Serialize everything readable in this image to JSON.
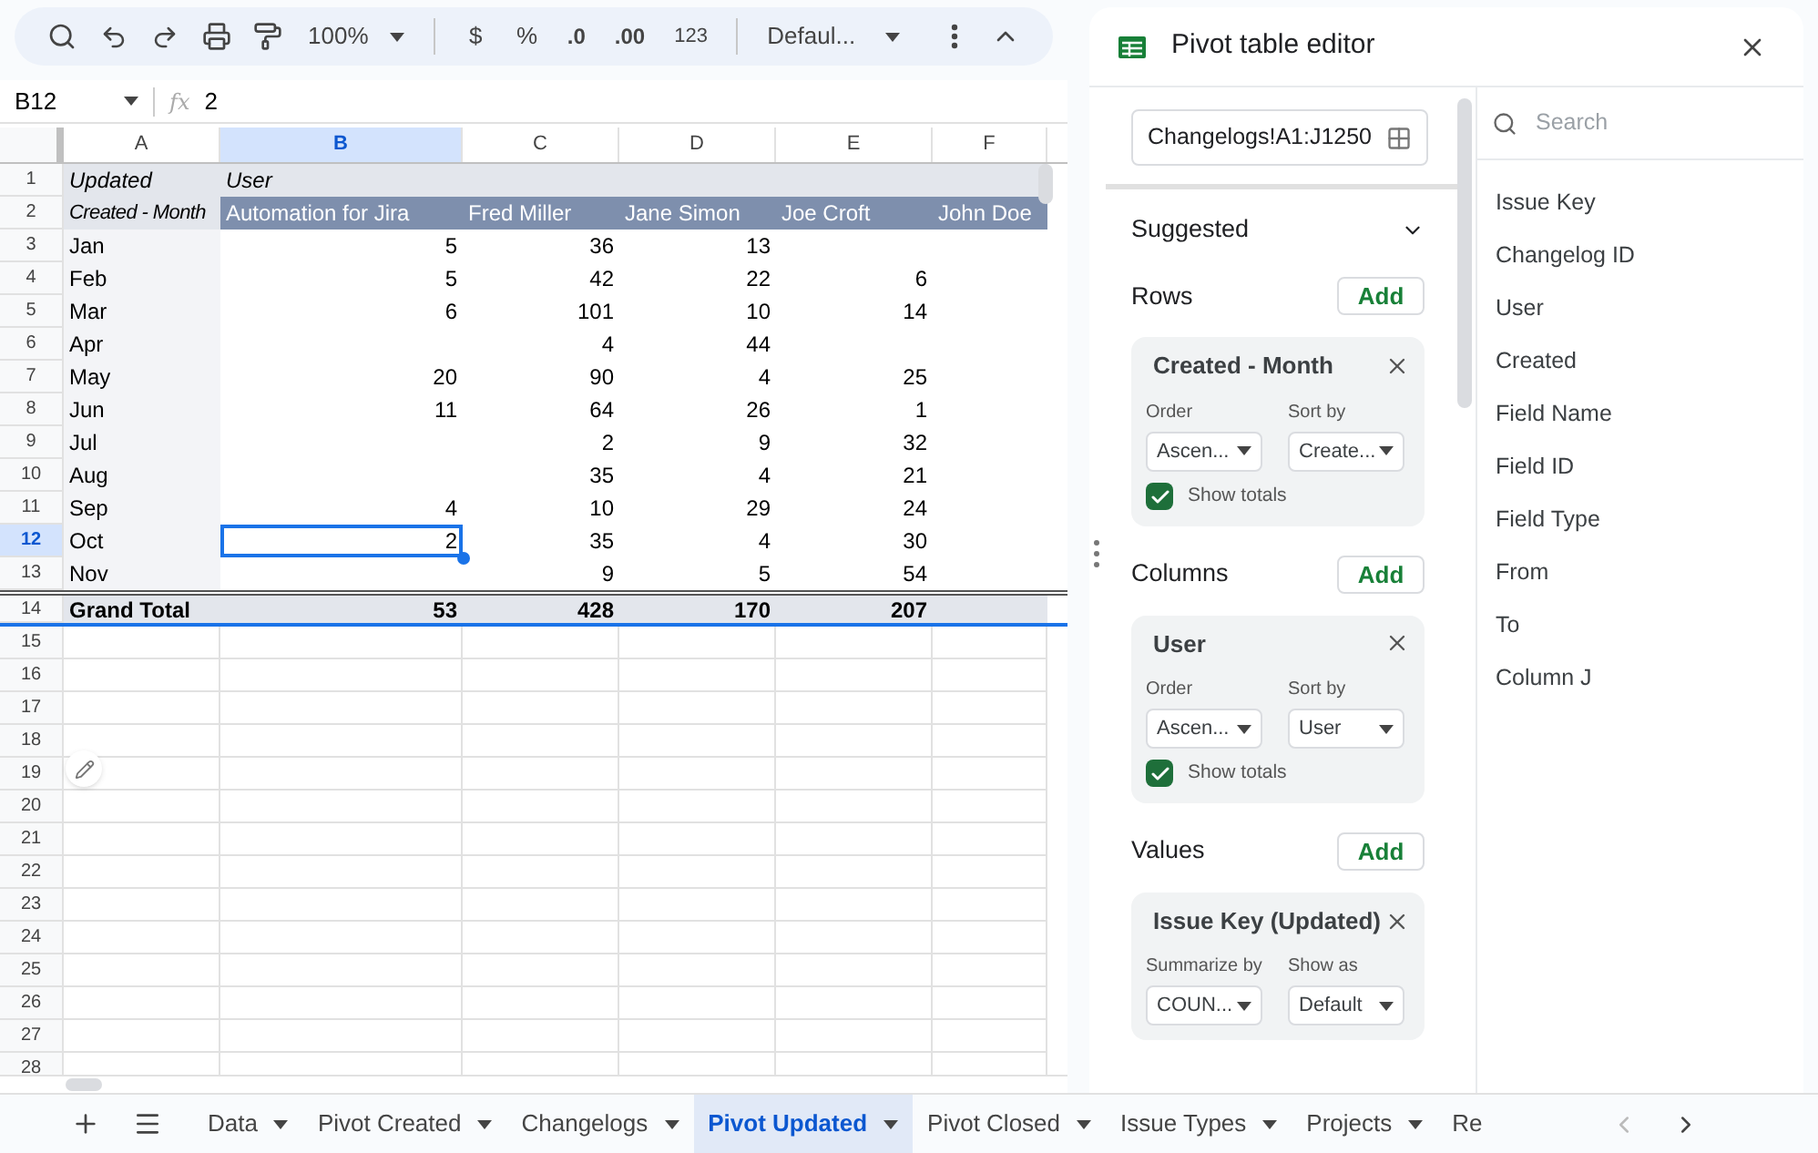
{
  "toolbar": {
    "zoom": "100%",
    "currency": "$",
    "percent": "%",
    "decrease_decimals": ".0",
    "increase_decimals": ".00",
    "number_format": "123",
    "font": "Defaul..."
  },
  "formula_bar": {
    "cell_ref": "B12",
    "fx": "fx",
    "value": "2"
  },
  "columns": [
    {
      "label": "A",
      "selected": false
    },
    {
      "label": "B",
      "selected": true
    },
    {
      "label": "C",
      "selected": false
    },
    {
      "label": "D",
      "selected": false
    },
    {
      "label": "E",
      "selected": false
    },
    {
      "label": "F",
      "selected": false
    }
  ],
  "rows": [
    {
      "number": "1",
      "selected": false,
      "kind": "pivot_title",
      "cells": [
        "Updated",
        "User",
        null,
        null,
        null,
        null
      ]
    },
    {
      "number": "2",
      "selected": false,
      "kind": "pivot_header",
      "cells": [
        "Created - Month",
        "Automation for Jira",
        "Fred Miller",
        "Jane Simon",
        "Joe Croft",
        "John Doe"
      ]
    },
    {
      "number": "3",
      "selected": false,
      "kind": "data",
      "cells": [
        "Jan",
        "5",
        "36",
        "13",
        null,
        null
      ]
    },
    {
      "number": "4",
      "selected": false,
      "kind": "data",
      "cells": [
        "Feb",
        "5",
        "42",
        "22",
        "6",
        null
      ]
    },
    {
      "number": "5",
      "selected": false,
      "kind": "data",
      "cells": [
        "Mar",
        "6",
        "101",
        "10",
        "14",
        null
      ]
    },
    {
      "number": "6",
      "selected": false,
      "kind": "data",
      "cells": [
        "Apr",
        null,
        "4",
        "44",
        null,
        null
      ]
    },
    {
      "number": "7",
      "selected": false,
      "kind": "data",
      "cells": [
        "May",
        "20",
        "90",
        "4",
        "25",
        null
      ]
    },
    {
      "number": "8",
      "selected": false,
      "kind": "data",
      "cells": [
        "Jun",
        "11",
        "64",
        "26",
        "1",
        null
      ]
    },
    {
      "number": "9",
      "selected": false,
      "kind": "data",
      "cells": [
        "Jul",
        null,
        "2",
        "9",
        "32",
        null
      ]
    },
    {
      "number": "10",
      "selected": false,
      "kind": "data",
      "cells": [
        "Aug",
        null,
        "35",
        "4",
        "21",
        null
      ]
    },
    {
      "number": "11",
      "selected": false,
      "kind": "data",
      "cells": [
        "Sep",
        "4",
        "10",
        "29",
        "24",
        null
      ]
    },
    {
      "number": "12",
      "selected": true,
      "kind": "data",
      "cells": [
        "Oct",
        "2",
        "35",
        "4",
        "30",
        null
      ]
    },
    {
      "number": "13",
      "selected": false,
      "kind": "data",
      "cells": [
        "Nov",
        null,
        "9",
        "5",
        "54",
        null
      ]
    },
    {
      "number": "14",
      "selected": false,
      "kind": "total",
      "cells": [
        "Grand Total",
        "53",
        "428",
        "170",
        "207",
        null
      ]
    },
    {
      "number": "15",
      "selected": false,
      "kind": "empty"
    },
    {
      "number": "16",
      "selected": false,
      "kind": "empty"
    },
    {
      "number": "17",
      "selected": false,
      "kind": "empty"
    },
    {
      "number": "18",
      "selected": false,
      "kind": "empty"
    },
    {
      "number": "19",
      "selected": false,
      "kind": "empty"
    },
    {
      "number": "20",
      "selected": false,
      "kind": "empty"
    },
    {
      "number": "21",
      "selected": false,
      "kind": "empty"
    },
    {
      "number": "22",
      "selected": false,
      "kind": "empty"
    },
    {
      "number": "23",
      "selected": false,
      "kind": "empty"
    },
    {
      "number": "24",
      "selected": false,
      "kind": "empty"
    },
    {
      "number": "25",
      "selected": false,
      "kind": "empty"
    },
    {
      "number": "26",
      "selected": false,
      "kind": "empty"
    },
    {
      "number": "27",
      "selected": false,
      "kind": "empty"
    },
    {
      "number": "28",
      "selected": false,
      "kind": "empty"
    }
  ],
  "sheet_tabs": [
    {
      "label": "Data",
      "selected": false
    },
    {
      "label": "Pivot Created",
      "selected": false
    },
    {
      "label": "Changelogs",
      "selected": false
    },
    {
      "label": "Pivot Updated",
      "selected": true
    },
    {
      "label": "Pivot Closed",
      "selected": false
    },
    {
      "label": "Issue Types",
      "selected": false
    },
    {
      "label": "Projects",
      "selected": false
    },
    {
      "label": "Re",
      "selected": false
    }
  ],
  "pivot_editor": {
    "title": "Pivot table editor",
    "range": "Changelogs!A1:J1250",
    "suggested": {
      "label": "Suggested",
      "expanded": false
    },
    "sections": [
      {
        "label": "Rows",
        "add": "Add",
        "card": {
          "title": "Created - Month",
          "fields": [
            {
              "label": "Order",
              "value": "Ascen..."
            },
            {
              "label": "Sort by",
              "value": "Create..."
            }
          ],
          "show_totals": {
            "label": "Show totals",
            "checked": true
          }
        }
      },
      {
        "label": "Columns",
        "add": "Add",
        "card": {
          "title": "User",
          "fields": [
            {
              "label": "Order",
              "value": "Ascen..."
            },
            {
              "label": "Sort by",
              "value": "User"
            }
          ],
          "show_totals": {
            "label": "Show totals",
            "checked": true
          }
        }
      },
      {
        "label": "Values",
        "add": "Add",
        "card": {
          "title": "Issue Key (Updated)",
          "fields": [
            {
              "label": "Summarize by",
              "value": "COUN..."
            },
            {
              "label": "Show as",
              "value": "Default"
            }
          ]
        }
      }
    ],
    "search": {
      "placeholder": "Search"
    },
    "fields": [
      "Issue Key",
      "Changelog ID",
      "User",
      "Created",
      "Field Name",
      "Field ID",
      "Field Type",
      "From",
      "To",
      "Column J"
    ]
  }
}
